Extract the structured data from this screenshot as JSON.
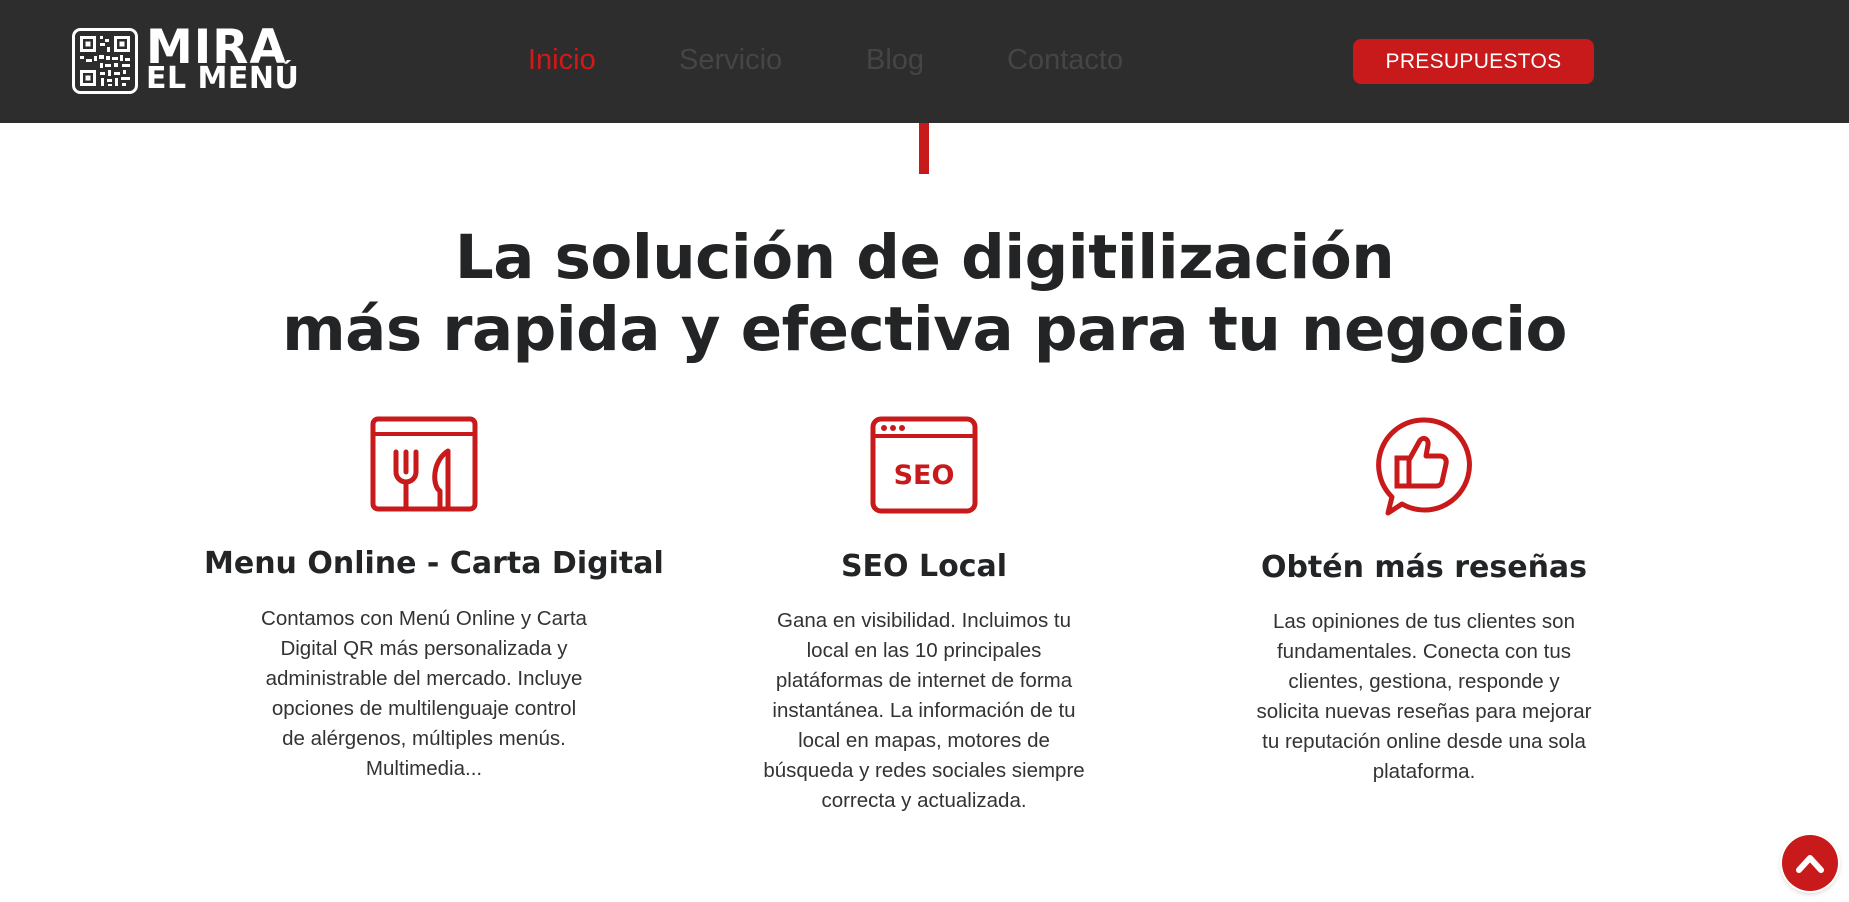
{
  "header": {
    "logo": {
      "line1": "MIRA",
      "line2": "EL MENÚ",
      "icon": "qr-code-icon"
    },
    "nav": [
      {
        "label": "Inicio",
        "active": true
      },
      {
        "label": "Servicio",
        "active": false
      },
      {
        "label": "Blog",
        "active": false
      },
      {
        "label": "Contacto",
        "active": false
      }
    ],
    "cta_label": "PRESUPUESTOS"
  },
  "hero": {
    "line1": "La solución de digitilización",
    "line2": "más rapida y efectiva para tu negocio"
  },
  "features": [
    {
      "icon": "restaurant-menu-icon",
      "title": "Menu Online - Carta Digital",
      "lines": [
        "Contamos con Menú Online y Carta",
        "Digital QR más personalizada y",
        "administrable del mercado. Incluye",
        "opciones de multilenguaje control",
        "de alérgenos, múltiples menús.",
        "Multimedia..."
      ]
    },
    {
      "icon": "seo-browser-icon",
      "icon_text": "SEO",
      "title": "SEO Local",
      "lines": [
        "Gana en visibilidad. Incluimos tu",
        "local en las 10 principales",
        "platáformas de internet de forma",
        "instantánea. La información de tu",
        "local en mapas, motores de",
        "búsqueda y redes sociales siempre",
        "correcta y actualizada."
      ]
    },
    {
      "icon": "thumbs-up-bubble-icon",
      "title": "Obtén más reseñas",
      "lines": [
        "Las opiniones de tus clientes son",
        "fundamentales. Conecta con tus",
        "clientes, gestiona, responde y",
        "solicita nuevas reseñas para mejorar",
        "tu reputación online desde una sola",
        "plataforma."
      ]
    }
  ],
  "colors": {
    "accent": "#c8191b",
    "header_bg": "#2d2d2d",
    "heading": "#222426"
  },
  "scroll_top": {
    "icon": "chevron-up-icon"
  }
}
